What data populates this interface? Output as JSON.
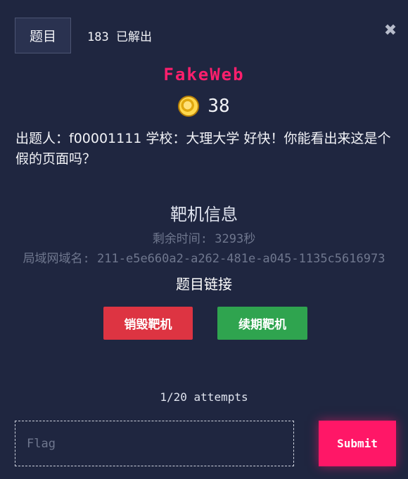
{
  "header": {
    "tab_label": "题目",
    "solves": "183 已解出",
    "close_glyph": "✖"
  },
  "challenge": {
    "title": "FakeWeb",
    "points": "38",
    "coin_icon": "coin-icon",
    "description": "出题人：f00001111 学校：大理大学 好快！你能看出来这是个假的页面吗？"
  },
  "target": {
    "section_title": "靶机信息",
    "remaining": "剩余时间: 3293秒",
    "domain": "局域网域名: 211-e5e660a2-a262-481e-a045-1135c5616973",
    "link_label": "题目链接",
    "destroy_label": "销毁靶机",
    "renew_label": "续期靶机"
  },
  "submission": {
    "attempts": "1/20 attempts",
    "flag_placeholder": "Flag",
    "flag_value": "",
    "submit_label": "Submit"
  },
  "colors": {
    "background": "#1f2640",
    "accent_pink": "#ff1767",
    "destroy_red": "#dd3442",
    "renew_green": "#2fa44f"
  }
}
